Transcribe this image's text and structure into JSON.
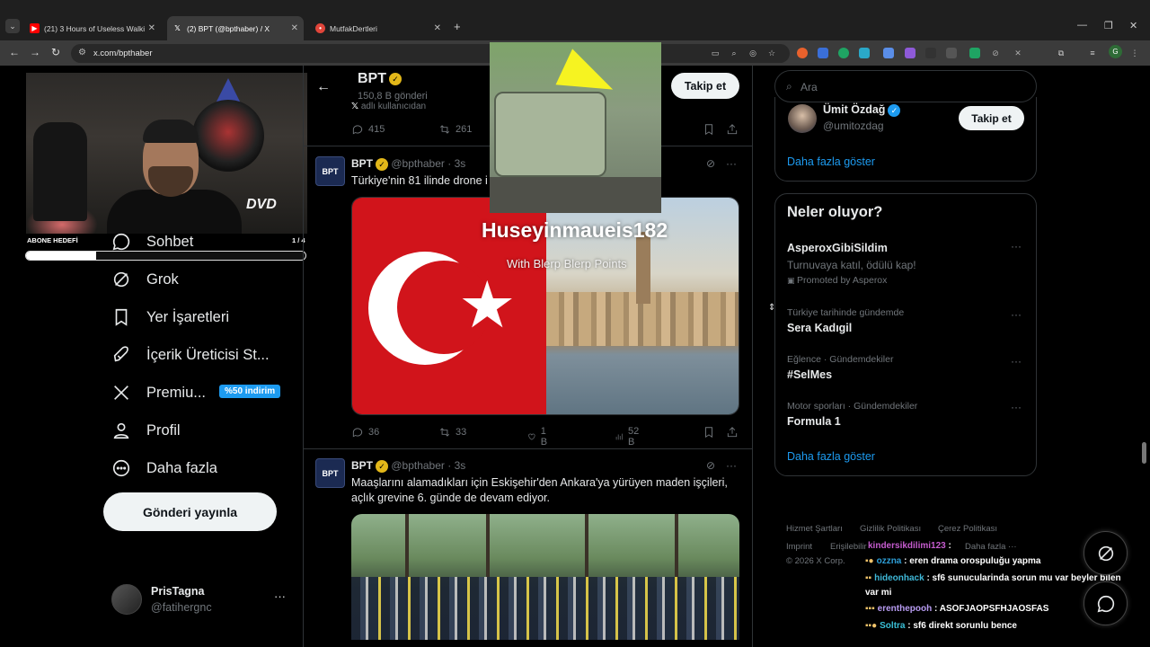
{
  "browser": {
    "tabs": [
      {
        "title": "(21) 3 Hours of Useless Walking",
        "favicon": "youtube-icon",
        "color": "#ff0000"
      },
      {
        "title": "(2) BPT (@bpthaber) / X",
        "favicon": "x-icon",
        "color": "#ffffff"
      },
      {
        "title": "MutfakDertleri",
        "favicon": "mutfak-icon",
        "color": "#e0453a"
      }
    ],
    "new_tab": "+",
    "url": "x.com/bpthaber"
  },
  "stream": {
    "sub_goal_label": "ABONE HEDEFİ",
    "sub_goal_count": "1 / 4",
    "sub_goal_progress": 0.25,
    "overlay_name": "Huseyinmaueis182",
    "overlay_sub": "With Blerp Blerp Points",
    "dvd_logo": "DVD"
  },
  "nav": {
    "items": [
      {
        "label": "Sohbet",
        "icon": "chat-icon"
      },
      {
        "label": "Grok",
        "icon": "grok-icon"
      },
      {
        "label": "Yer İşaretleri",
        "icon": "bookmark-icon"
      },
      {
        "label": "İçerik Üreticisi St...",
        "icon": "rocket-icon"
      },
      {
        "label": "Premiu...",
        "icon": "x-logo-icon"
      },
      {
        "label": "Profil",
        "icon": "profile-icon"
      },
      {
        "label": "Daha fazla",
        "icon": "more-circle-icon"
      }
    ],
    "premium_badge": "%50 indirim",
    "post_button": "Gönderi yayınla",
    "me": {
      "name": "PrisTagna",
      "handle": "@fatihergnc",
      "more": "···"
    }
  },
  "profile_header": {
    "name": "BPT",
    "post_count": "150,8 B gönderi",
    "subline": "adlı kullanıcıdan",
    "follow_button": "Takip et"
  },
  "tweets": [
    {
      "stats": {
        "replies": "415",
        "retweets": "261"
      }
    },
    {
      "avatar": "BPT",
      "name": "BPT",
      "handle": "@bpthaber",
      "time": "3s",
      "text": "Türkiye'nin 81 ilinde drone i",
      "stats": {
        "replies": "36",
        "retweets": "33",
        "likes": "1 B",
        "views": "52 B"
      }
    },
    {
      "avatar": "BPT",
      "name": "BPT",
      "handle": "@bpthaber",
      "time": "3s",
      "text": "Maaşlarını alamadıkları için Eskişehir'den Ankara'ya yürüyen maden işçileri, açlık grevine 6. günde de devam ediyor."
    }
  ],
  "right": {
    "search_placeholder": "Ara",
    "suggestion": {
      "name": "Ümit Özdağ",
      "handle": "@umitozdag",
      "follow": "Takip et"
    },
    "show_more": "Daha fazla göster",
    "trends_title": "Neler oluyor?",
    "trends": [
      {
        "name": "AsperoxGibiSildim",
        "desc": "Turnuvaya katıl, ödülü kap!",
        "promo": "Promoted by Asperox"
      },
      {
        "category": "Türkiye tarihinde gündemde",
        "name": "Sera Kadıgil"
      },
      {
        "category": "Eğlence · Gündemdekiler",
        "name": "#SelMes"
      },
      {
        "category": "Motor sporları · Gündemdekiler",
        "name": "Formula 1"
      }
    ],
    "trends_show_more": "Daha fazla göster",
    "footer": {
      "links": [
        "Hizmet Şartları",
        "Gizlilik Politikası",
        "Çerez Politikası",
        "Imprint",
        "Erişilebilir",
        "Daha fazla ···"
      ],
      "copyright": "© 2026 X Corp."
    }
  },
  "chat": [
    {
      "user": "kindersikdilimi123",
      "text": ":"
    },
    {
      "user": "ozzna",
      "text": ": eren drama orospuluğu yapma"
    },
    {
      "user": "hideonhack",
      "text": ": sf6 sunucularinda sorun mu var beyler bilen var mi"
    },
    {
      "user": "erenthepooh",
      "text": ": ASOFJAOPSFHJAOSFAS"
    },
    {
      "user": "Soltra",
      "text": ": sf6 direkt sorunlu bence"
    }
  ]
}
